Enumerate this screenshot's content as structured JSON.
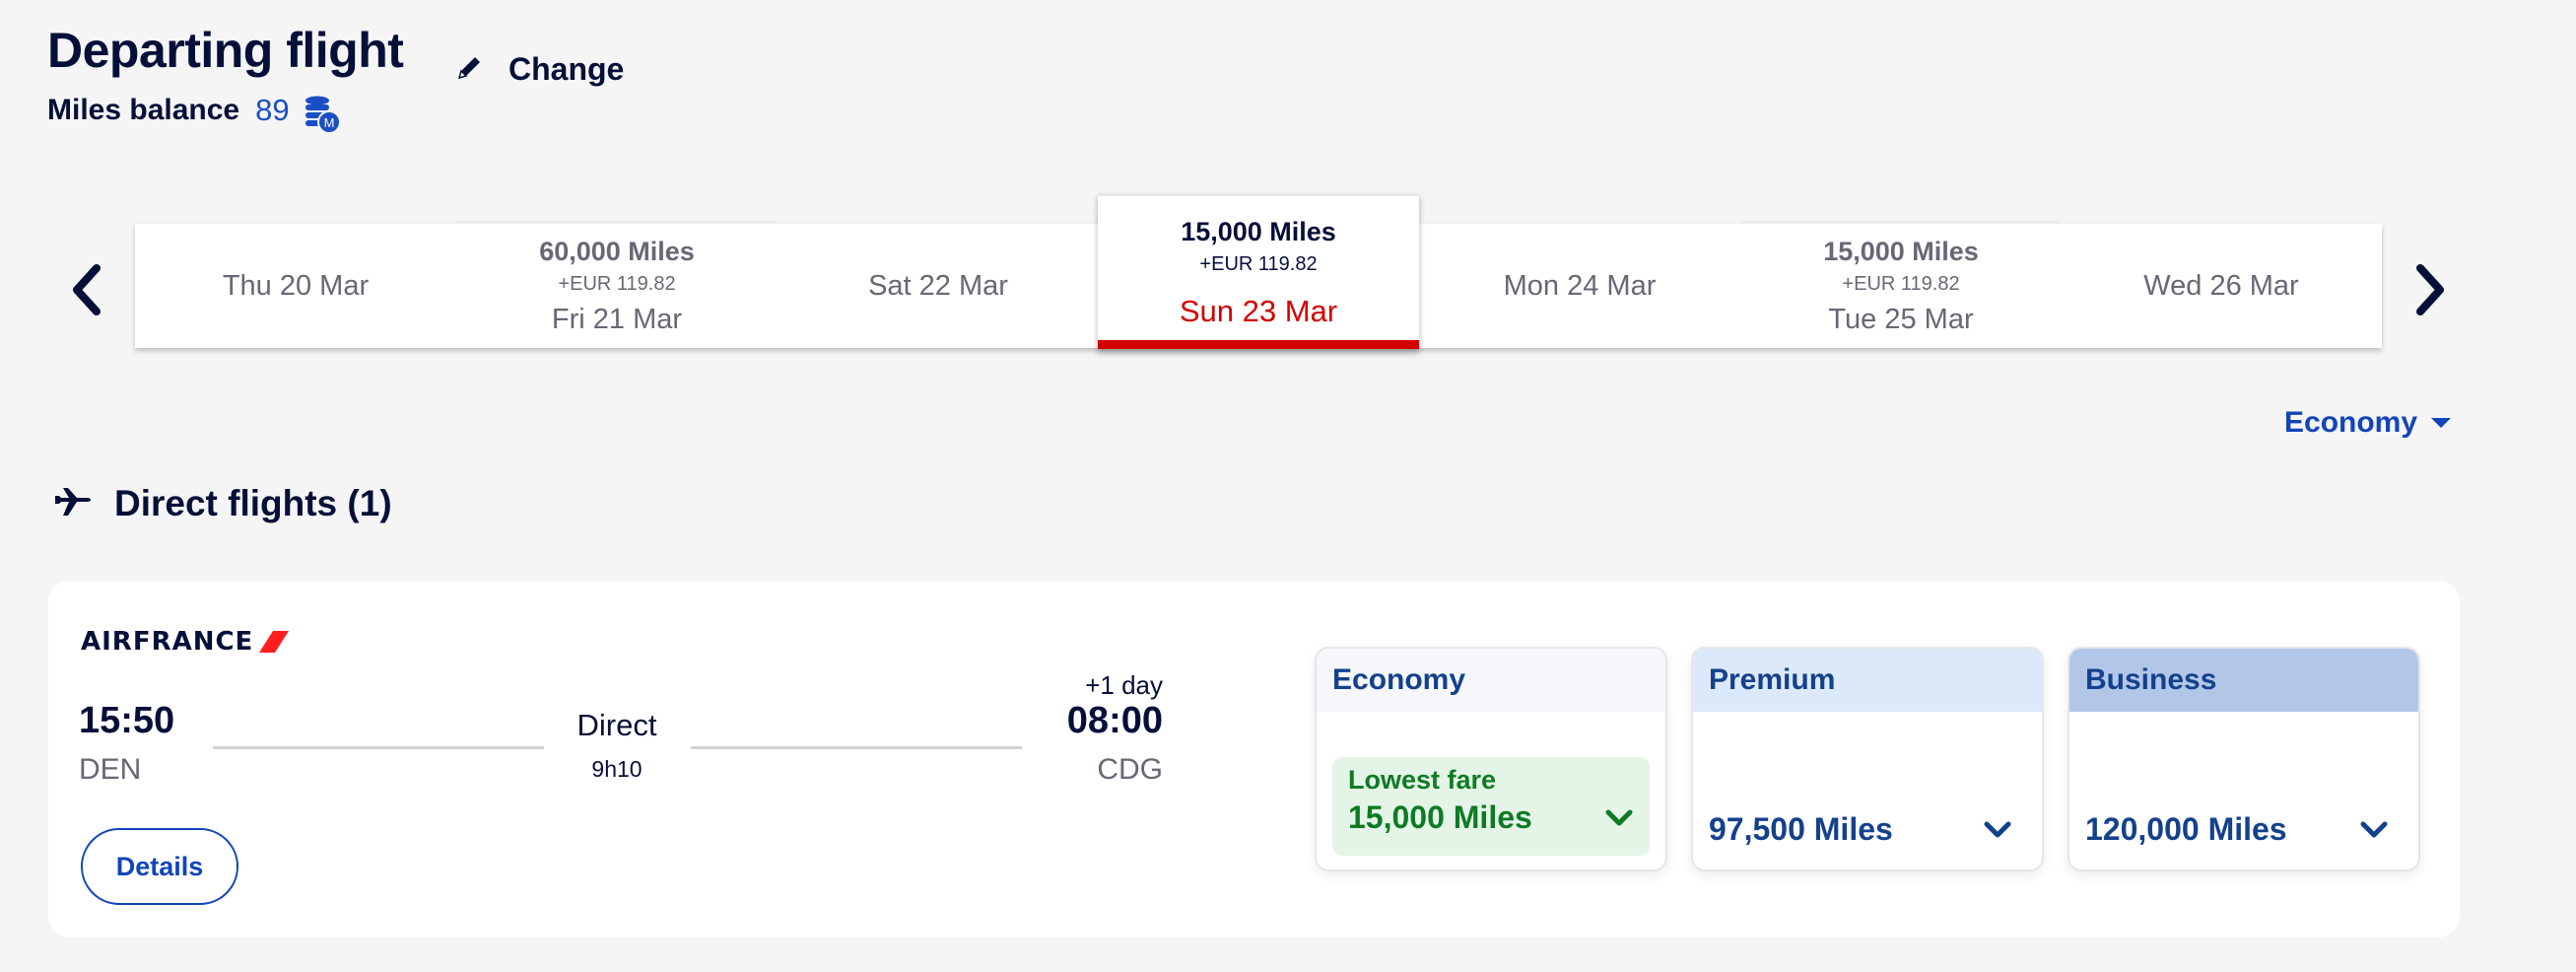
{
  "header": {
    "title": "Departing flight",
    "miles_balance_label": "Miles balance",
    "miles_balance_value": "89",
    "change_label": "Change"
  },
  "date_strip": {
    "days": [
      {
        "date": "Thu 20 Mar",
        "price": null,
        "tax": null,
        "selected": false
      },
      {
        "date": "Fri 21 Mar",
        "price": "60,000 Miles",
        "tax": "+EUR 119.82",
        "selected": false
      },
      {
        "date": "Sat 22 Mar",
        "price": null,
        "tax": null,
        "selected": false
      },
      {
        "date": "Sun 23 Mar",
        "price": "15,000 Miles",
        "tax": "+EUR 119.82",
        "selected": true
      },
      {
        "date": "Mon 24 Mar",
        "price": null,
        "tax": null,
        "selected": false
      },
      {
        "date": "Tue 25 Mar",
        "price": "15,000 Miles",
        "tax": "+EUR 119.82",
        "selected": false
      },
      {
        "date": "Wed 26 Mar",
        "price": null,
        "tax": null,
        "selected": false
      }
    ]
  },
  "cabin_select": {
    "selected": "Economy"
  },
  "section": {
    "title": "Direct flights (1)"
  },
  "flight": {
    "airline": "AIRFRANCE",
    "departure_time": "15:50",
    "departure_airport": "DEN",
    "stop_type": "Direct",
    "duration": "9h10",
    "arrival_day_offset": "+1 day",
    "arrival_time": "08:00",
    "arrival_airport": "CDG",
    "details_label": "Details",
    "fares": [
      {
        "cabin": "Economy",
        "tag": "Lowest fare",
        "price": "15,000 Miles"
      },
      {
        "cabin": "Premium",
        "price": "97,500 Miles"
      },
      {
        "cabin": "Business",
        "price": "120,000 Miles"
      }
    ]
  },
  "colors": {
    "brand_navy": "#051039",
    "accent_blue": "#1145b8",
    "selected_red": "#d30000",
    "lowest_green": "#0f7a24"
  }
}
